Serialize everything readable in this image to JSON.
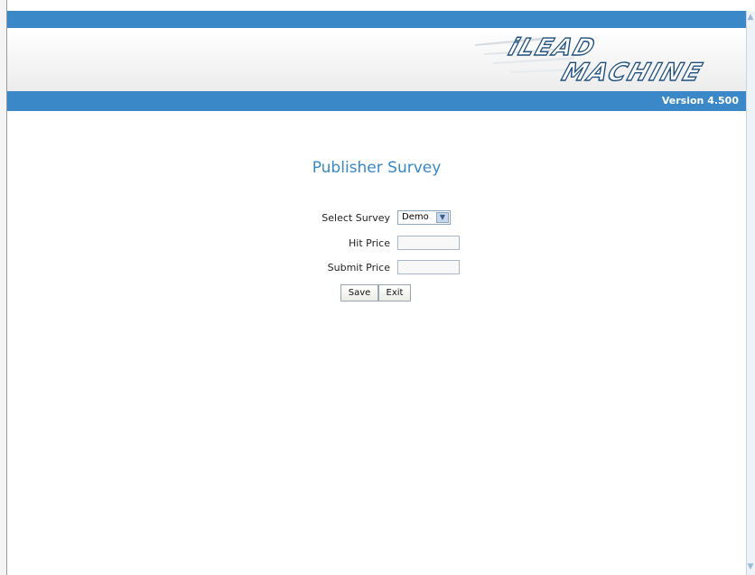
{
  "header": {
    "logo_text": "iLEAD MACHINE",
    "version": "Version 4.500"
  },
  "page": {
    "title": "Publisher Survey"
  },
  "form": {
    "select_survey_label": "Select Survey",
    "select_survey_value": "Demo",
    "hit_price_label": "Hit Price",
    "hit_price_value": "",
    "submit_price_label": "Submit Price",
    "submit_price_value": "",
    "save_label": "Save",
    "exit_label": "Exit"
  },
  "colors": {
    "brand_blue": "#3a88c7",
    "logo_blue": "#2b6fb0"
  },
  "icons": {
    "dropdown": "chevron-down-icon",
    "scroll_up": "scroll-up-icon",
    "scroll_down": "scroll-down-icon"
  }
}
